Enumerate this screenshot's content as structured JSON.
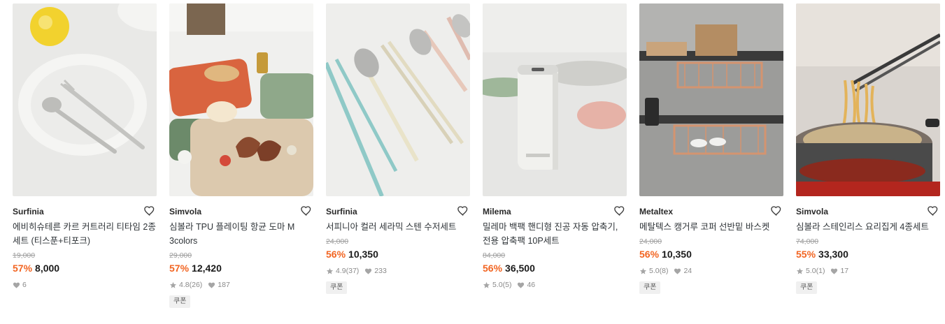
{
  "colors": {
    "discount": "#f26522",
    "text": "#292929",
    "muted": "#9e9e9e"
  },
  "products": [
    {
      "brand": "Surfinia",
      "title": "에비히슈테른 카르 커트러리 티타임 2종 세트 (티스푼+티포크)",
      "original_price": "19,000",
      "discount": "57%",
      "price": "8,000",
      "rating": "",
      "review_count": "",
      "likes": "6",
      "coupon": "",
      "image_icon": "cutlery-plate-image"
    },
    {
      "brand": "Simvola",
      "title": "심볼라 TPU 플레이팅 항균 도마 M 3colors",
      "original_price": "29,000",
      "discount": "57%",
      "price": "12,420",
      "rating": "4.8",
      "review_count": "(26)",
      "likes": "187",
      "coupon": "쿠폰",
      "image_icon": "cutting-board-image"
    },
    {
      "brand": "Surfinia",
      "title": "서피니아 컬러 세라믹 스텐 수저세트",
      "original_price": "24,000",
      "discount": "56%",
      "price": "10,350",
      "rating": "4.9",
      "review_count": "(37)",
      "likes": "233",
      "coupon": "쿠폰",
      "image_icon": "spoon-chopsticks-image"
    },
    {
      "brand": "Milema",
      "title": "밀레마 백팩 핸디형 진공 자동 압축기, 전용 압축팩 10P세트",
      "original_price": "84,000",
      "discount": "56%",
      "price": "36,500",
      "rating": "5.0",
      "review_count": "(5)",
      "likes": "46",
      "coupon": "",
      "image_icon": "vacuum-sealer-image"
    },
    {
      "brand": "Metaltex",
      "title": "메탈텍스 캥거루 코퍼 선반밑 바스켓",
      "original_price": "24,000",
      "discount": "56%",
      "price": "10,350",
      "rating": "5.0",
      "review_count": "(8)",
      "likes": "24",
      "coupon": "쿠폰",
      "image_icon": "shelf-basket-image"
    },
    {
      "brand": "Simvola",
      "title": "심볼라 스테인리스 요리집게 4종세트",
      "original_price": "74,000",
      "discount": "55%",
      "price": "33,300",
      "rating": "5.0",
      "review_count": "(1)",
      "likes": "17",
      "coupon": "쿠폰",
      "image_icon": "tongs-pot-image"
    }
  ]
}
